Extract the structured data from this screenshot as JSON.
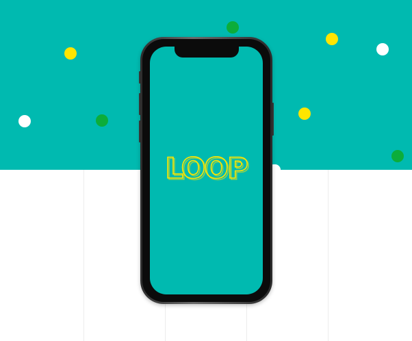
{
  "colors": {
    "teal": "#00bab0",
    "yellow": "#ffe500",
    "green": "#0cad3a",
    "white": "#ffffff",
    "grid": "#ececec",
    "phone_frame": "#4a4a4a"
  },
  "logo": {
    "text": "LOOP"
  }
}
